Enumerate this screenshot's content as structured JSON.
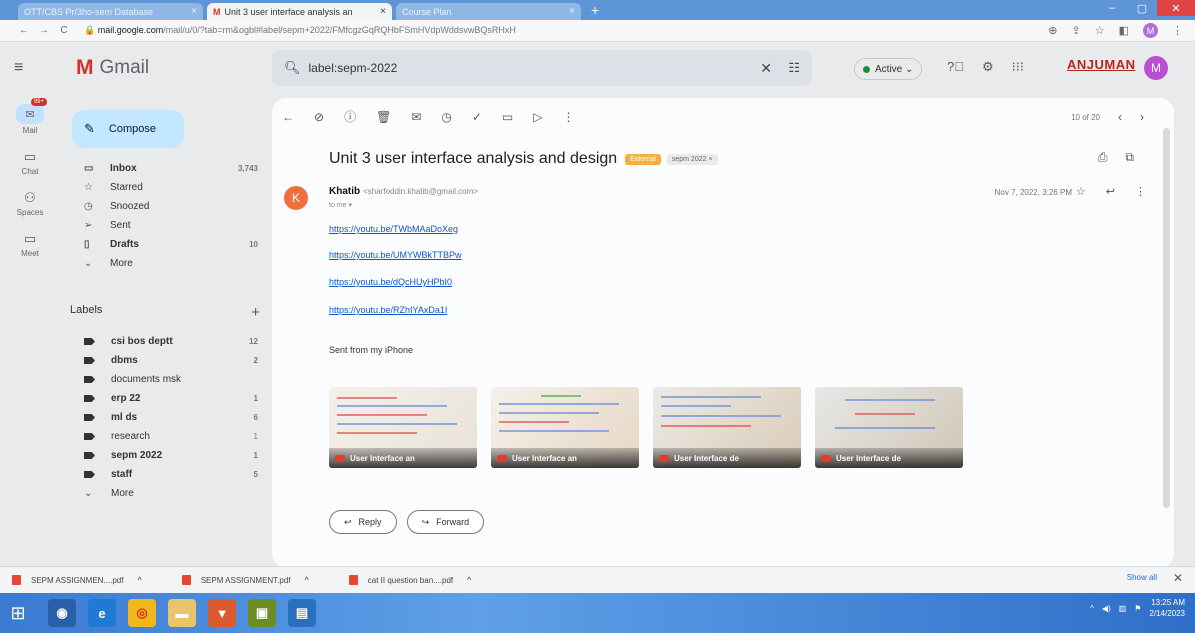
{
  "browser": {
    "tabs": [
      {
        "title": "OTT/CBS Pr/3ho-sem Database",
        "active": false
      },
      {
        "title": "Unit 3 user interface analysis an",
        "active": true
      },
      {
        "title": "Course Plan",
        "active": false
      }
    ],
    "url_host": "mail.google.com",
    "url_rest": "/mail/u/0/?tab=rm&ogbl#label/sepm+2022/FMfcgzGqRQHbFSmHVdpWddsvwBQsRHxH"
  },
  "gmail": {
    "app_name": "Gmail",
    "search_value": "label:sepm-2022",
    "status": "Active",
    "brand_text": "ANJUMAN",
    "avatar_letter": "M"
  },
  "rail": [
    {
      "label": "Mail",
      "icon": "mail-icon",
      "badge": "99+"
    },
    {
      "label": "Chat",
      "icon": "chat-icon"
    },
    {
      "label": "Spaces",
      "icon": "spaces-icon"
    },
    {
      "label": "Meet",
      "icon": "meet-icon"
    }
  ],
  "sidebar": {
    "compose_label": "Compose",
    "folders": [
      {
        "label": "Inbox",
        "count": "3,743",
        "icon": "▭",
        "bold": true
      },
      {
        "label": "Starred",
        "count": "",
        "icon": "☆",
        "bold": false
      },
      {
        "label": "Snoozed",
        "count": "",
        "icon": "◷",
        "bold": false
      },
      {
        "label": "Sent",
        "count": "",
        "icon": "➢",
        "bold": false
      },
      {
        "label": "Drafts",
        "count": "10",
        "icon": "▯",
        "bold": true
      },
      {
        "label": "More",
        "count": "",
        "icon": "⌄",
        "bold": false
      }
    ],
    "labels_heading": "Labels",
    "labels": [
      {
        "label": "csi bos deptt",
        "count": "12",
        "bold": true
      },
      {
        "label": "dbms",
        "count": "2",
        "bold": true
      },
      {
        "label": "documents msk",
        "count": "",
        "bold": false
      },
      {
        "label": "erp 22",
        "count": "1",
        "bold": true
      },
      {
        "label": "ml ds",
        "count": "6",
        "bold": true
      },
      {
        "label": "research",
        "count": "1",
        "bold": false
      },
      {
        "label": "sepm 2022",
        "count": "1",
        "bold": true
      },
      {
        "label": "staff",
        "count": "5",
        "bold": true
      },
      {
        "label": "More",
        "count": "",
        "bold": false
      }
    ]
  },
  "message": {
    "pager": "10 of 20",
    "subject": "Unit 3 user interface analysis and design",
    "chip_external": "External",
    "chip_label": "sepm 2022 ×",
    "sender_initial": "K",
    "sender_name": "Khatib",
    "sender_email": "<sharfoddin.khatib@gmail.com>",
    "to": "to me ▾",
    "date": "Nov 7, 2022, 3:26 PM",
    "links": [
      "https://youtu.be/TWbMAaDoXeg",
      "https://youtu.be/UMYWBkTTBPw",
      "https://youtu.be/dQcHUyHPbI0",
      "https://youtu.be/RZhIYAxDa1I"
    ],
    "signature": "Sent from my iPhone",
    "thumbnails": [
      "User Interface an",
      "User Interface an",
      "User Interface de",
      "User Interface de"
    ],
    "reply_label": "Reply",
    "forward_label": "Forward"
  },
  "downloads": {
    "items": [
      "SEPM ASSIGNMEN....pdf",
      "SEPM ASSIGNMENT.pdf",
      "cat II question ban....pdf"
    ],
    "show_all": "Show all"
  },
  "taskbar": {
    "time": "13:25 AM",
    "date": "2/14/2023"
  }
}
